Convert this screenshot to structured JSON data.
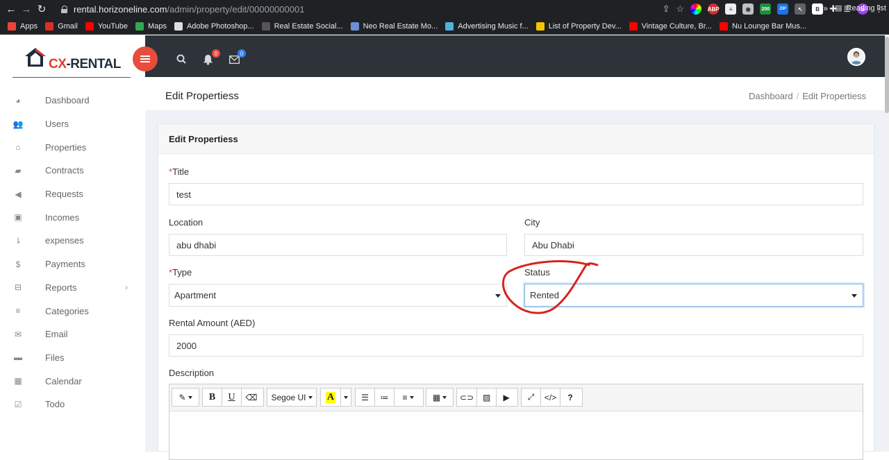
{
  "browser": {
    "url_host": "rental.horizoneline.com",
    "url_path": "/admin/property/edit/00000000001",
    "ext_badge": "200",
    "profile_letter": "S",
    "bookmarks": [
      {
        "label": "Apps",
        "color": "#e8453c"
      },
      {
        "label": "Gmail",
        "color": "#d93025"
      },
      {
        "label": "YouTube",
        "color": "#ff0000"
      },
      {
        "label": "Maps",
        "color": "#34a853"
      },
      {
        "label": "Adobe Photoshop...",
        "color": "#ddd"
      },
      {
        "label": "Real Estate Social...",
        "color": "#555"
      },
      {
        "label": "Neo Real Estate Mo...",
        "color": "#6b8fd6"
      },
      {
        "label": "Advertising Music f...",
        "color": "#4fb3d9"
      },
      {
        "label": "List of Property Dev...",
        "color": "#f2c500"
      },
      {
        "label": "Vintage Culture, Br...",
        "color": "#ff0000"
      },
      {
        "label": "Nu Lounge Bar Mus...",
        "color": "#ff0000"
      }
    ],
    "more": "»",
    "reading_list": "Reading list"
  },
  "logo": {
    "cx": "CX",
    "rest": "-RENTAL"
  },
  "sidebar": {
    "items": [
      {
        "label": "Dashboard",
        "icon": "dashboard-icon",
        "glyph": "◕"
      },
      {
        "label": "Users",
        "icon": "users-icon",
        "glyph": "👥"
      },
      {
        "label": "Properties",
        "icon": "home-icon",
        "glyph": "⌂"
      },
      {
        "label": "Contracts",
        "icon": "book-icon",
        "glyph": "▰"
      },
      {
        "label": "Requests",
        "icon": "megaphone-icon",
        "glyph": "◀"
      },
      {
        "label": "Incomes",
        "icon": "money-icon",
        "glyph": "▣"
      },
      {
        "label": "expenses",
        "icon": "sort-icon",
        "glyph": "⇂"
      },
      {
        "label": "Payments",
        "icon": "dollar-icon",
        "glyph": "$"
      },
      {
        "label": "Reports",
        "icon": "inbox-icon",
        "glyph": "⊟",
        "chevron": "›"
      },
      {
        "label": "Categories",
        "icon": "list-icon",
        "glyph": "≡"
      },
      {
        "label": "Email",
        "icon": "envelope-icon",
        "glyph": "✉"
      },
      {
        "label": "Files",
        "icon": "folder-icon",
        "glyph": "▬"
      },
      {
        "label": "Calendar",
        "icon": "calendar-icon",
        "glyph": "▦"
      },
      {
        "label": "Todo",
        "icon": "checkbox-icon",
        "glyph": "☑"
      }
    ]
  },
  "topbar": {
    "notifications_count": "0",
    "messages_count": "0",
    "badge_red": "#e74c3c",
    "badge_blue": "#2f80ed"
  },
  "page": {
    "title": "Edit Propertiess",
    "breadcrumb_home": "Dashboard",
    "breadcrumb_current": "Edit Propertiess"
  },
  "form": {
    "card_title": "Edit Propertiess",
    "title_label": "Title",
    "title_value": "test",
    "location_label": "Location",
    "location_value": "abu dhabi",
    "city_label": "City",
    "city_value": "Abu Dhabi",
    "type_label": "Type",
    "type_value": "Apartment",
    "status_label": "Status",
    "status_value": "Rented",
    "rental_label": "Rental Amount (AED)",
    "rental_value": "2000",
    "description_label": "Description",
    "required_mark": "*"
  },
  "editor_toolbar": {
    "font_name": "Segoe UI",
    "bold": "B",
    "underline": "U",
    "help": "?",
    "codeview": "</>"
  },
  "annotation_color": "#d9221c"
}
